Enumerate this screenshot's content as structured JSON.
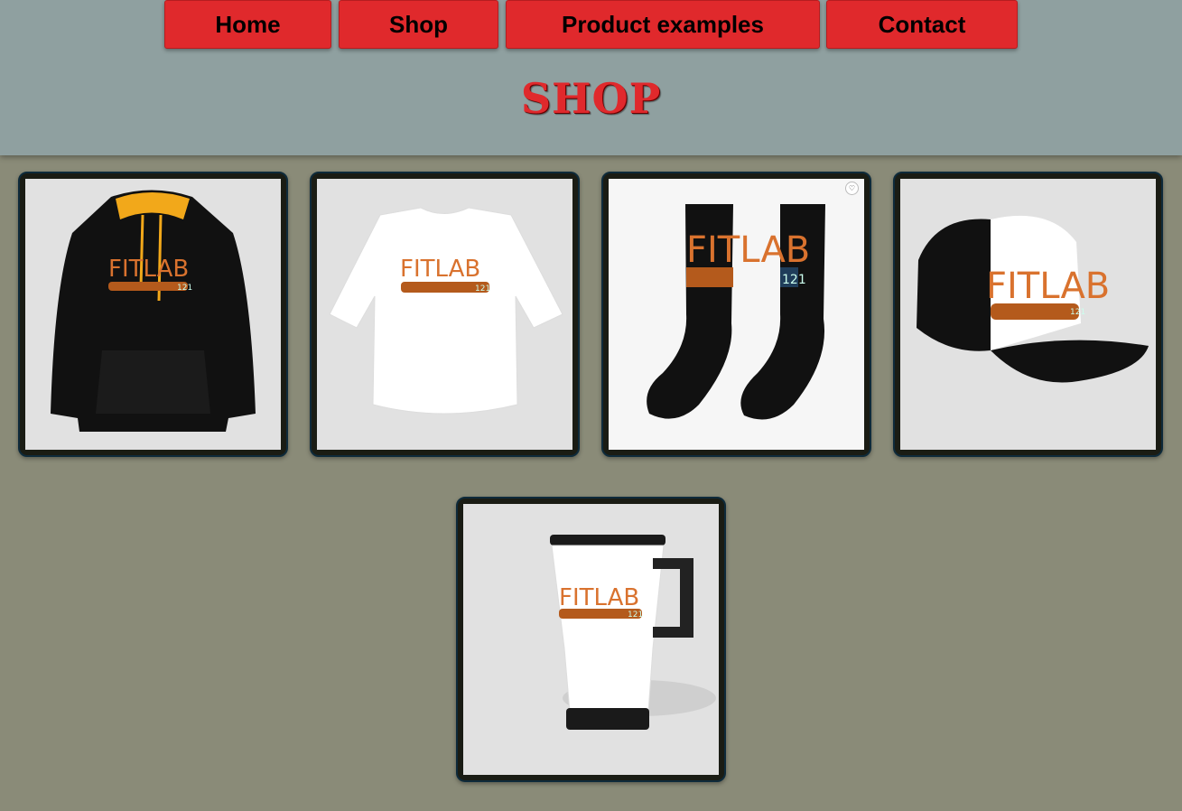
{
  "nav": {
    "items": [
      {
        "label": "Home"
      },
      {
        "label": "Shop"
      },
      {
        "label": "Product examples"
      },
      {
        "label": "Contact"
      }
    ]
  },
  "page": {
    "title": "SHOP"
  },
  "products": [
    {
      "name": "hoodie",
      "logo": "FITLAB",
      "logo_sub": "121"
    },
    {
      "name": "crop-tshirt",
      "logo": "FITLAB",
      "logo_sub": "121"
    },
    {
      "name": "socks",
      "logo": "FITLAB",
      "logo_sub": "121"
    },
    {
      "name": "trucker-cap",
      "logo": "FITLAB",
      "logo_sub": "121"
    },
    {
      "name": "travel-mug",
      "logo": "FITLAB",
      "logo_sub": "121"
    }
  ],
  "colors": {
    "accent": "#e0292c",
    "header_bg": "#8fa0a0",
    "page_bg": "#8a8b78",
    "logo_orange": "#d9722e",
    "hood_lining": "#f2a81a"
  },
  "icons": {
    "favorite": "heart-icon"
  }
}
